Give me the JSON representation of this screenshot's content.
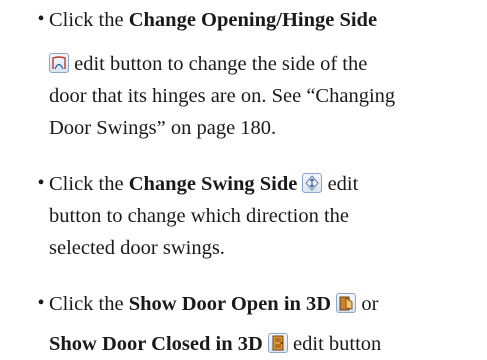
{
  "bullets": [
    {
      "lines": [
        {
          "pre": "Click the ",
          "bold": "Change Opening/Hinge Side",
          "post": ""
        },
        {
          "icon": "hinge-side-icon",
          "post": " edit button to change the side of the"
        },
        {
          "post": "door that its hinges are on. See “Changing"
        },
        {
          "post": "Door Swings” on page 180."
        }
      ]
    },
    {
      "lines": [
        {
          "pre": "Click the ",
          "bold": "Change Swing Side",
          "icon": "swing-side-icon",
          "post": " edit"
        },
        {
          "post": "button to change which direction the"
        },
        {
          "post": "selected door swings."
        }
      ]
    },
    {
      "lines": [
        {
          "pre": "Click the ",
          "bold": "Show Door Open in 3D",
          "icon": "door-open-3d-icon",
          "post": " or"
        },
        {
          "bold": "Show Door Closed in 3D",
          "icon": "door-closed-3d-icon",
          "post": " edit button"
        }
      ]
    }
  ],
  "bullet_char": "•"
}
